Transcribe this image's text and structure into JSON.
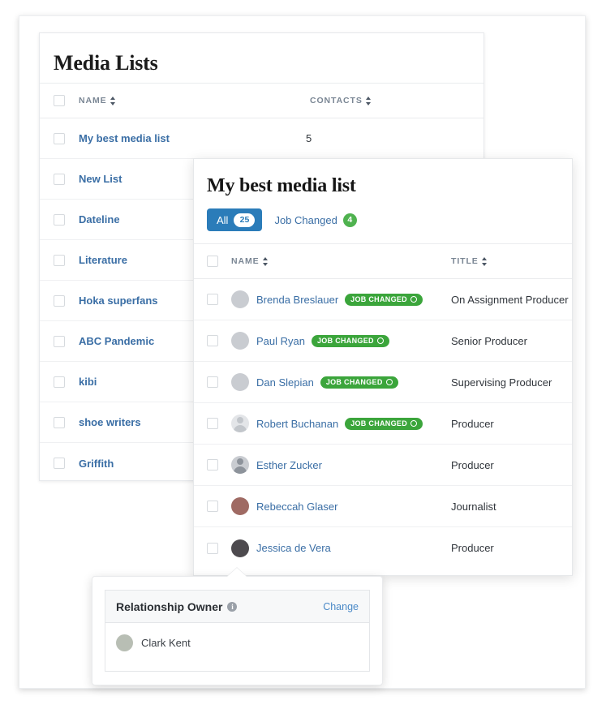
{
  "media_lists": {
    "title": "Media Lists",
    "columns": [
      {
        "label": "NAME",
        "sort_icon": "sort-updown-icon"
      },
      {
        "label": "CONTACTS",
        "sort_icon": "sort-updown-icon"
      }
    ],
    "rows": [
      {
        "name": "My best media list",
        "contacts": "5"
      },
      {
        "name": "New List",
        "contacts": ""
      },
      {
        "name": "Dateline",
        "contacts": ""
      },
      {
        "name": "Literature",
        "contacts": ""
      },
      {
        "name": "Hoka superfans",
        "contacts": ""
      },
      {
        "name": "ABC Pandemic",
        "contacts": ""
      },
      {
        "name": "kibi",
        "contacts": ""
      },
      {
        "name": "shoe writers",
        "contacts": ""
      },
      {
        "name": "Griffith",
        "contacts": ""
      }
    ]
  },
  "list_modal": {
    "title": "My best media list",
    "filters": [
      {
        "label": "All",
        "count": "25",
        "active": true
      },
      {
        "label": "Job Changed",
        "count": "4",
        "active": false
      }
    ],
    "columns": [
      {
        "label": "NAME",
        "sort_icon": "sort-updown-icon"
      },
      {
        "label": "TITLE",
        "sort_icon": "sort-updown-icon"
      }
    ],
    "contacts": [
      {
        "name": "Brenda Breslauer",
        "badge": "JOB CHANGED",
        "title": "On Assignment Producer",
        "avatar": "photo"
      },
      {
        "name": "Paul Ryan",
        "badge": "JOB CHANGED",
        "title": "Senior Producer",
        "avatar": "photo"
      },
      {
        "name": "Dan Slepian",
        "badge": "JOB CHANGED",
        "title": "Supervising Producer",
        "avatar": "photo"
      },
      {
        "name": "Robert Buchanan",
        "badge": "JOB CHANGED",
        "title": "Producer",
        "avatar": "silhouette-light"
      },
      {
        "name": "Esther Zucker",
        "badge": "",
        "title": "Producer",
        "avatar": "silhouette"
      },
      {
        "name": "Rebeccah Glaser",
        "badge": "",
        "title": "Journalist",
        "avatar": "photo"
      },
      {
        "name": "Jessica de Vera",
        "badge": "",
        "title": "Producer",
        "avatar": "photo"
      }
    ]
  },
  "owner_popover": {
    "title": "Relationship Owner",
    "info_icon": "info-circle-icon",
    "change_label": "Change",
    "owner_name": "Clark Kent"
  },
  "colors": {
    "link_blue": "#3a6ea5",
    "accent_blue": "#2b7cb9",
    "badge_green": "#3ba53b",
    "count_green": "#4fb24f",
    "text_dark": "#30353b",
    "border": "#eaecee"
  }
}
